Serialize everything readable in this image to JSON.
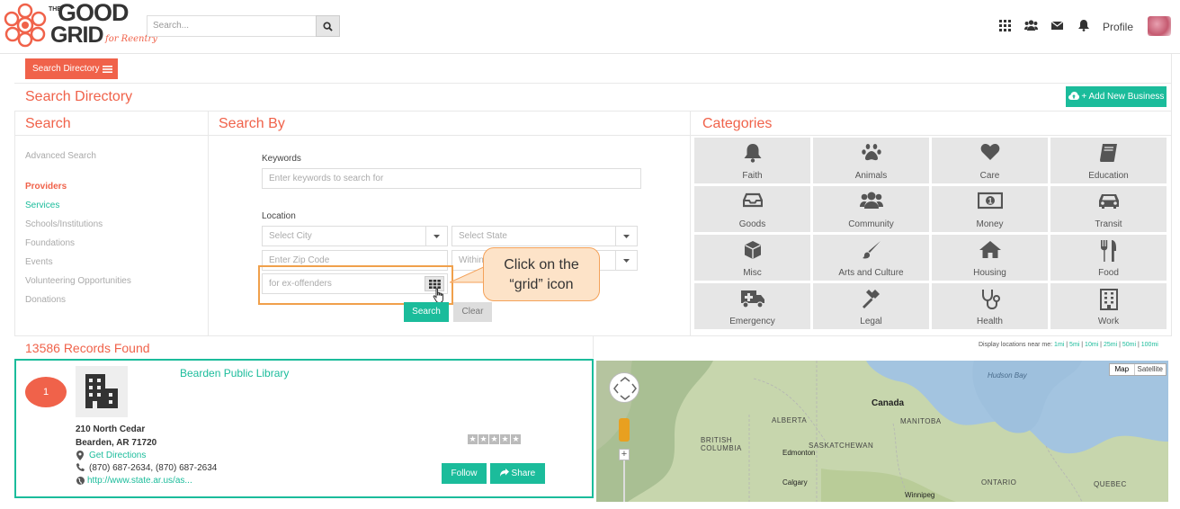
{
  "brand": {
    "logo_text_1": "THE",
    "logo_text_2": "GOOD",
    "logo_text_3": "GRID",
    "logo_tagline": "for Reentry"
  },
  "header": {
    "search_placeholder": "Search...",
    "profile_label": "Profile"
  },
  "toolbar": {
    "search_directory_label": "Search Directory"
  },
  "page": {
    "title": "Search Directory",
    "add_business_label": "+ Add New Business"
  },
  "search_panel": {
    "title": "Search",
    "advanced": "Advanced Search",
    "items": [
      {
        "label": "Providers"
      },
      {
        "label": "Services"
      },
      {
        "label": "Schools/Institutions"
      },
      {
        "label": "Foundations"
      },
      {
        "label": "Events"
      },
      {
        "label": "Volunteering Opportunities"
      },
      {
        "label": "Donations"
      }
    ]
  },
  "search_by": {
    "title": "Search By",
    "keywords_label": "Keywords",
    "keywords_placeholder": "Enter keywords to search for",
    "location_label": "Location",
    "city_placeholder": "Select City",
    "state_placeholder": "Select State",
    "zip_placeholder": "Enter Zip Code",
    "within_placeholder": "Within",
    "ex_offenders_value": "for ex-offenders",
    "search_button": "Search",
    "clear_button": "Clear"
  },
  "callout": {
    "line1": "Click on the",
    "line2": "“grid” icon"
  },
  "categories": {
    "title": "Categories",
    "items": [
      {
        "label": "Faith",
        "icon": "bell-icon"
      },
      {
        "label": "Animals",
        "icon": "paw-icon"
      },
      {
        "label": "Care",
        "icon": "heart-icon"
      },
      {
        "label": "Education",
        "icon": "book-icon"
      },
      {
        "label": "Goods",
        "icon": "inbox-icon"
      },
      {
        "label": "Community",
        "icon": "users-icon"
      },
      {
        "label": "Money",
        "icon": "money-icon"
      },
      {
        "label": "Transit",
        "icon": "car-icon"
      },
      {
        "label": "Misc",
        "icon": "cube-icon"
      },
      {
        "label": "Arts and Culture",
        "icon": "brush-icon"
      },
      {
        "label": "Housing",
        "icon": "home-icon"
      },
      {
        "label": "Food",
        "icon": "cutlery-icon"
      },
      {
        "label": "Emergency",
        "icon": "ambulance-icon"
      },
      {
        "label": "Legal",
        "icon": "gavel-icon"
      },
      {
        "label": "Health",
        "icon": "stethoscope-icon"
      },
      {
        "label": "Work",
        "icon": "building-icon"
      }
    ]
  },
  "results": {
    "count_label": "13586 Records Found",
    "display_near_label": "Display locations near me:",
    "distances": [
      "1mi",
      "5mi",
      "10mi",
      "25mi",
      "50mi",
      "100mi"
    ],
    "items": [
      {
        "rank": "1",
        "name": "Bearden Public Library",
        "address1": "210 North Cedar",
        "address2": "Bearden, AR 71720",
        "directions": "Get Directions",
        "phone": "(870) 687-2634, (870) 687-2634",
        "website": "http://www.state.ar.us/as...",
        "follow": "Follow",
        "share": "Share"
      }
    ]
  },
  "map": {
    "map_btn": "Map",
    "satellite_btn": "Satellite",
    "labels": [
      "Hudson Bay",
      "Canada",
      "ALBERTA",
      "MANITOBA",
      "BRITISH COLUMBIA",
      "SASKATCHEWAN",
      "Edmonton",
      "Calgary",
      "ONTARIO",
      "QUEBEC",
      "Winnipeg"
    ]
  },
  "colors": {
    "accent": "#f0624a",
    "teal": "#1bbc9b",
    "callout_fill": "#fde3c8",
    "callout_border": "#f4a25a"
  }
}
